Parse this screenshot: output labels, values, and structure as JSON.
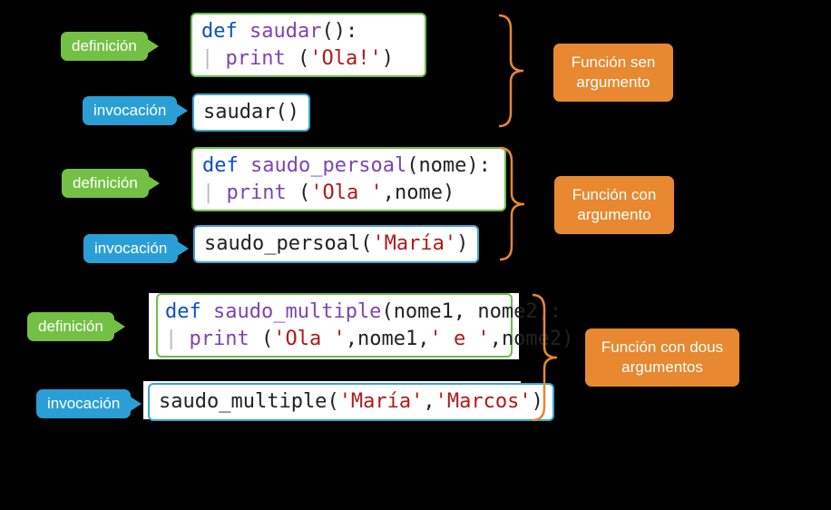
{
  "labels": {
    "definition": "definición",
    "invocation": "invocación"
  },
  "sections": [
    {
      "definition_code": [
        {
          "kind": "kw",
          "t": "def"
        },
        {
          "kind": "sp",
          "t": " "
        },
        {
          "kind": "fn",
          "t": "saudar"
        },
        {
          "kind": "pn",
          "t": "():"
        },
        {
          "kind": "nl"
        },
        {
          "kind": "guide",
          "t": "  "
        },
        {
          "kind": "fn",
          "t": "print"
        },
        {
          "kind": "sp",
          "t": " "
        },
        {
          "kind": "pn",
          "t": "("
        },
        {
          "kind": "str",
          "t": "'Ola!'"
        },
        {
          "kind": "pn",
          "t": ")"
        }
      ],
      "invocation_code": [
        {
          "kind": "nm",
          "t": "saudar"
        },
        {
          "kind": "pn",
          "t": "()"
        }
      ],
      "description": "Función sen\nargumento"
    },
    {
      "definition_code": [
        {
          "kind": "kw",
          "t": "def"
        },
        {
          "kind": "sp",
          "t": " "
        },
        {
          "kind": "fn",
          "t": "saudo_persoal"
        },
        {
          "kind": "pn",
          "t": "("
        },
        {
          "kind": "nm",
          "t": "nome"
        },
        {
          "kind": "pn",
          "t": "):"
        },
        {
          "kind": "nl"
        },
        {
          "kind": "guide",
          "t": "  "
        },
        {
          "kind": "fn",
          "t": "print"
        },
        {
          "kind": "sp",
          "t": " "
        },
        {
          "kind": "pn",
          "t": "("
        },
        {
          "kind": "str",
          "t": "'Ola '"
        },
        {
          "kind": "pn",
          "t": ","
        },
        {
          "kind": "nm",
          "t": "nome"
        },
        {
          "kind": "pn",
          "t": ")"
        }
      ],
      "invocation_code": [
        {
          "kind": "nm",
          "t": "saudo_persoal"
        },
        {
          "kind": "pn",
          "t": "("
        },
        {
          "kind": "str",
          "t": "'María'"
        },
        {
          "kind": "pn",
          "t": ")"
        }
      ],
      "description": "Función con\nargumento"
    },
    {
      "definition_code": [
        {
          "kind": "kw",
          "t": "def"
        },
        {
          "kind": "sp",
          "t": " "
        },
        {
          "kind": "fn",
          "t": "saudo_multiple"
        },
        {
          "kind": "pn",
          "t": "("
        },
        {
          "kind": "nm",
          "t": "nome1"
        },
        {
          "kind": "pn",
          "t": ", "
        },
        {
          "kind": "nm",
          "t": "nome2"
        },
        {
          "kind": "pn",
          "t": "):"
        },
        {
          "kind": "nl"
        },
        {
          "kind": "guide",
          "t": "  "
        },
        {
          "kind": "fn",
          "t": "print"
        },
        {
          "kind": "sp",
          "t": " "
        },
        {
          "kind": "pn",
          "t": "("
        },
        {
          "kind": "str",
          "t": "'Ola '"
        },
        {
          "kind": "pn",
          "t": ","
        },
        {
          "kind": "nm",
          "t": "nome1"
        },
        {
          "kind": "pn",
          "t": ","
        },
        {
          "kind": "str",
          "t": "' e '"
        },
        {
          "kind": "pn",
          "t": ","
        },
        {
          "kind": "nm",
          "t": "nome2"
        },
        {
          "kind": "pn",
          "t": ")"
        }
      ],
      "invocation_code": [
        {
          "kind": "nm",
          "t": "saudo_multiple"
        },
        {
          "kind": "pn",
          "t": "("
        },
        {
          "kind": "str",
          "t": "'María'"
        },
        {
          "kind": "pn",
          "t": ","
        },
        {
          "kind": "str",
          "t": "'Marcos'"
        },
        {
          "kind": "pn",
          "t": ")"
        }
      ],
      "description": "Función con dous\nargumentos"
    }
  ]
}
